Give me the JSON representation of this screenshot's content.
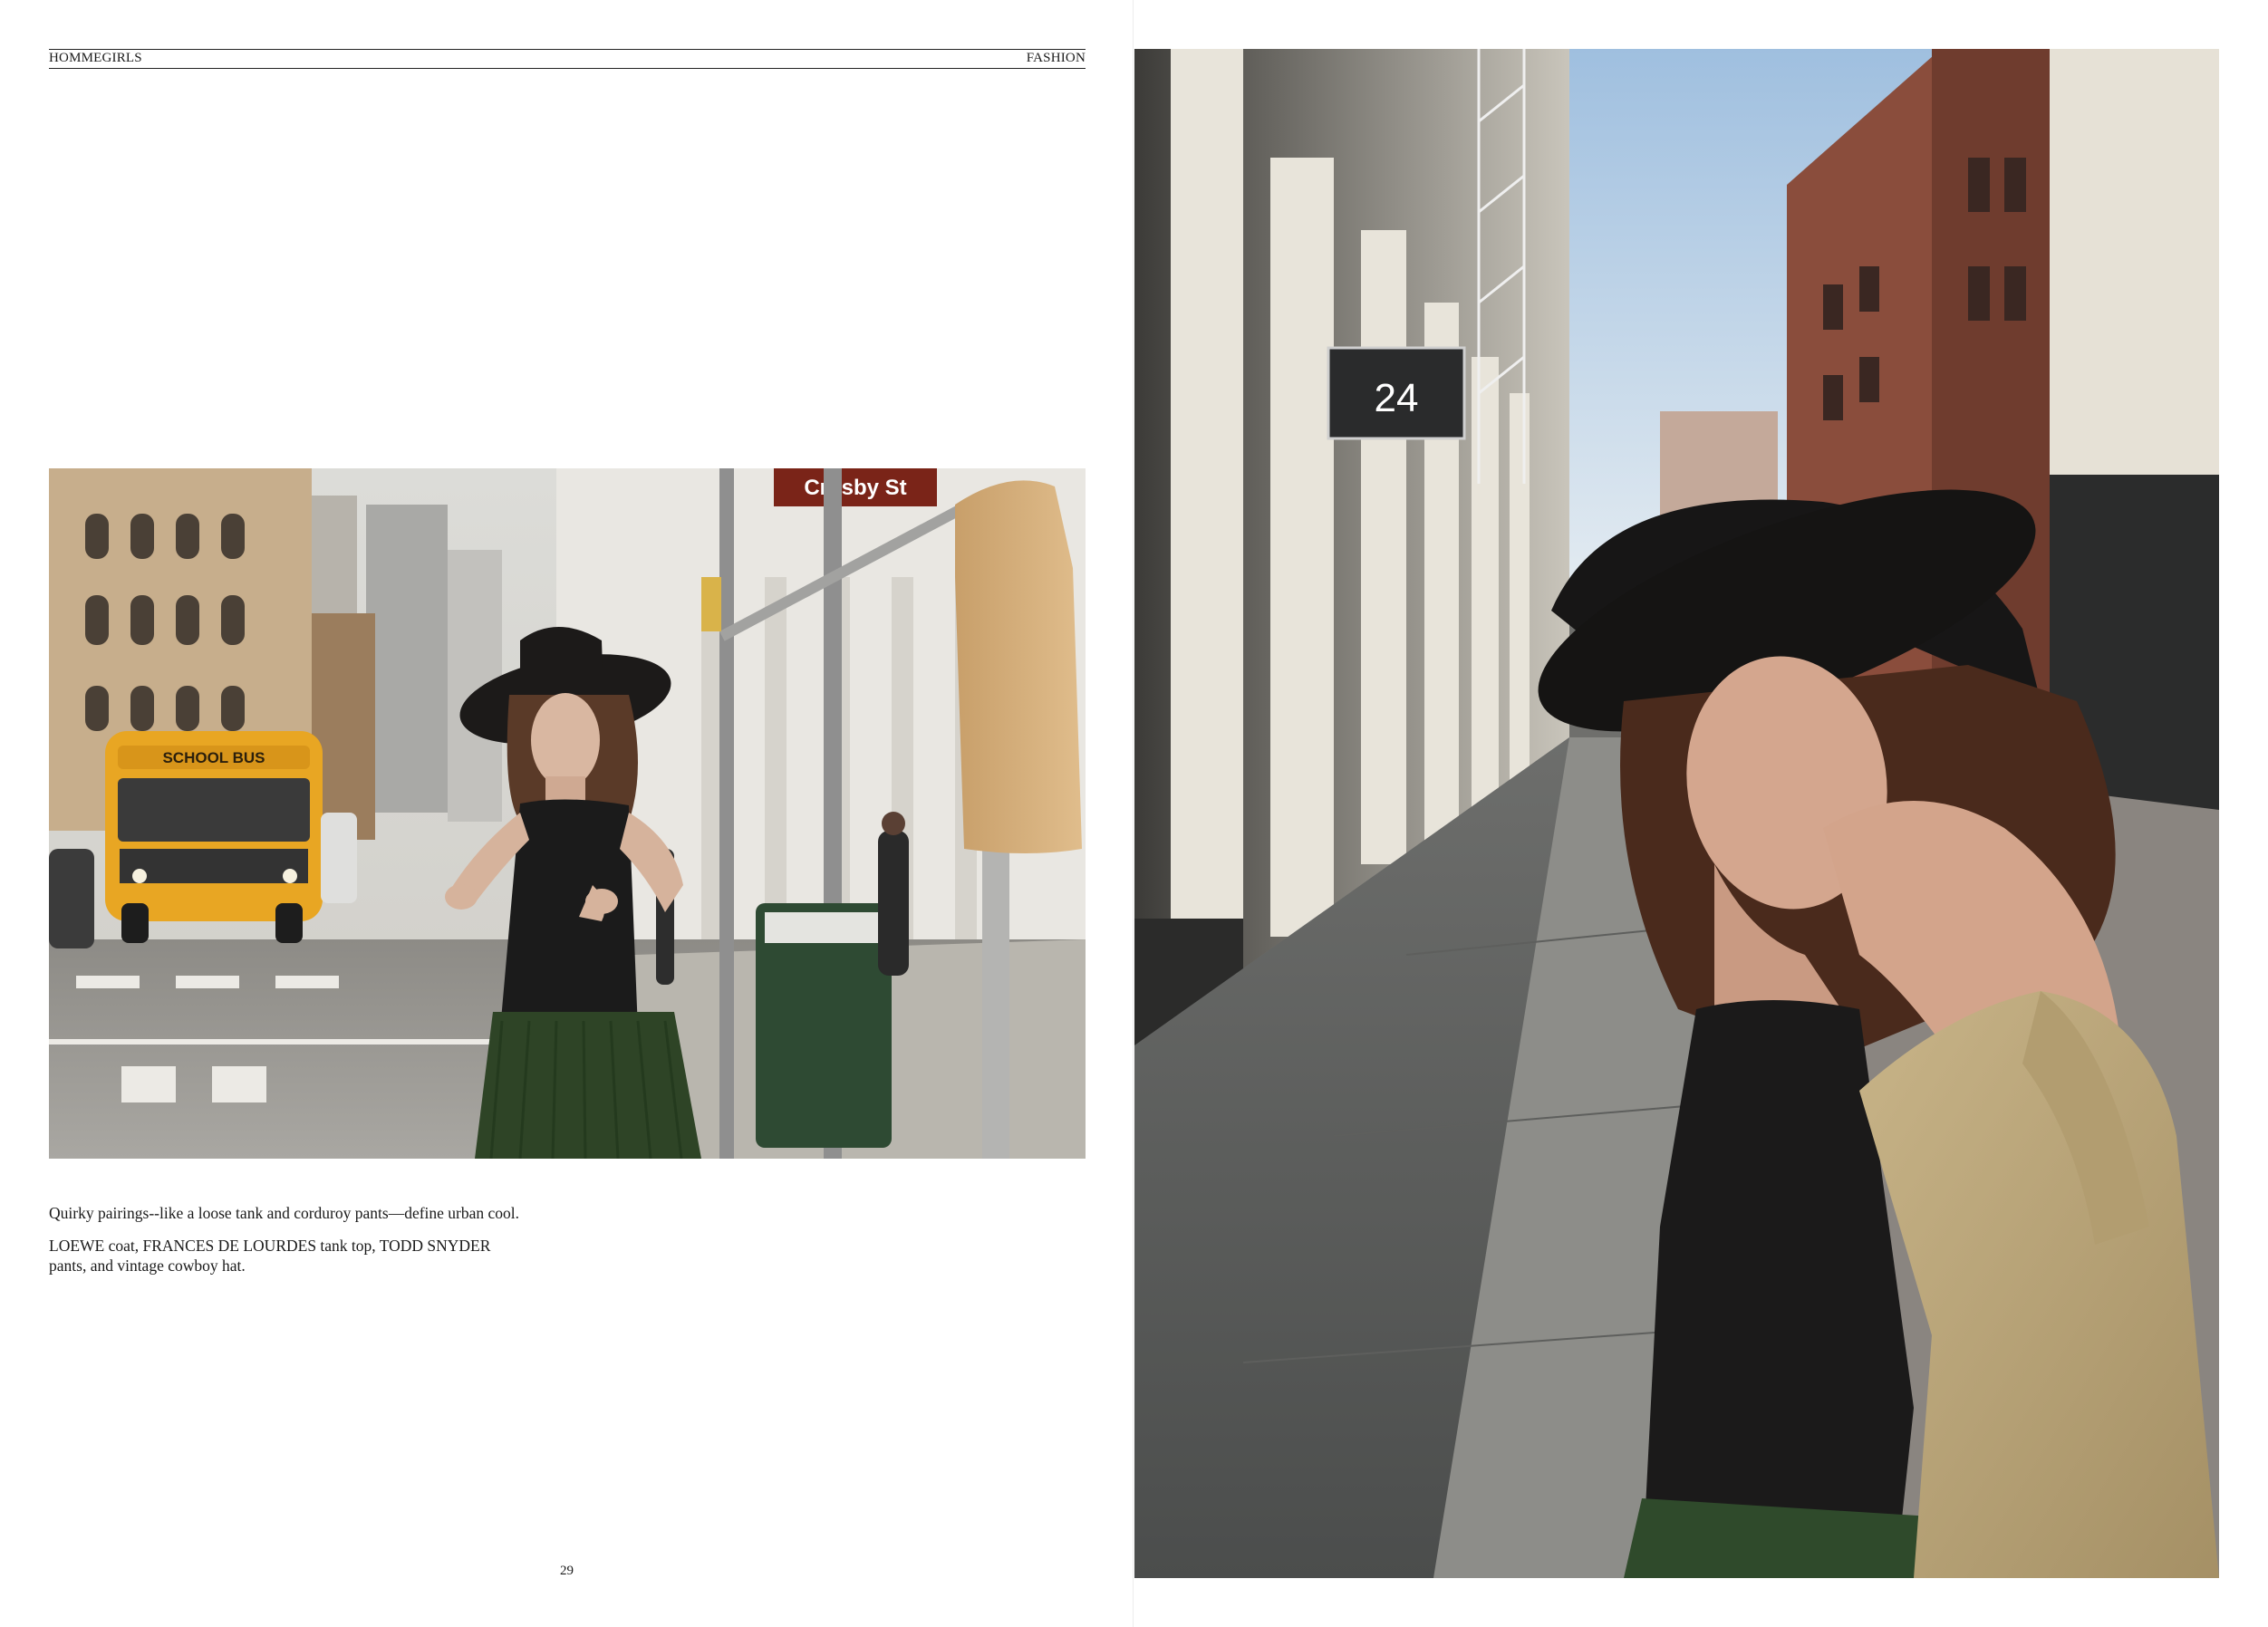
{
  "header": {
    "magazine": "HOMMEGIRLS",
    "section": "FASHION"
  },
  "left_photo": {
    "street_sign": "Crosby St",
    "bus_sign": "SCHOOL BUS"
  },
  "caption": {
    "headline": "Quirky pairings--like a loose tank and corduroy pants—define urban cool.",
    "credits_line1": "LOEWE coat, FRANCES DE LOURDES tank top, TODD SNYDER",
    "credits_line2": "pants, and vintage cowboy hat."
  },
  "folio": "29",
  "right_photo": {
    "door_number": "24"
  }
}
